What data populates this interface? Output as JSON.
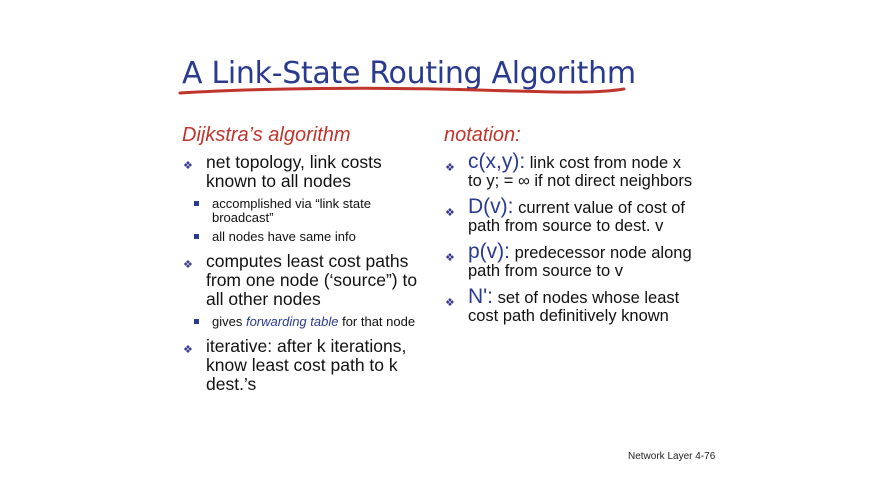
{
  "title": "A Link-State Routing Algorithm",
  "colors": {
    "title": "#2a3b8f",
    "heading": "#c0352b",
    "underline": "#c0352b"
  },
  "left": {
    "heading": "Dijkstra’s algorithm",
    "items": [
      {
        "text": "net topology, link costs known to all nodes",
        "subitems": [
          "accomplished via “link state broadcast”",
          "all nodes have same info"
        ]
      },
      {
        "text": "computes least cost paths from one node (‘source”) to all other nodes"
      },
      {
        "text": "iterative: after k iterations, know least cost path to k dest.’s"
      }
    ],
    "sub_gives": {
      "before": "gives ",
      "italic": "forwarding table",
      "after": " for that node"
    }
  },
  "right": {
    "heading": "notation:",
    "items": [
      {
        "term": "c(x,y):",
        "desc": " link cost from node x to y;  = ∞ if not direct neighbors"
      },
      {
        "term": "D(v):",
        "desc": " current value of cost of path from source to dest. v"
      },
      {
        "term": "p(v):",
        "desc": " predecessor node along path from source to v"
      },
      {
        "term": "N':",
        "desc": " set of nodes whose least cost path definitively known"
      }
    ]
  },
  "footer": "Network Layer  4-76"
}
